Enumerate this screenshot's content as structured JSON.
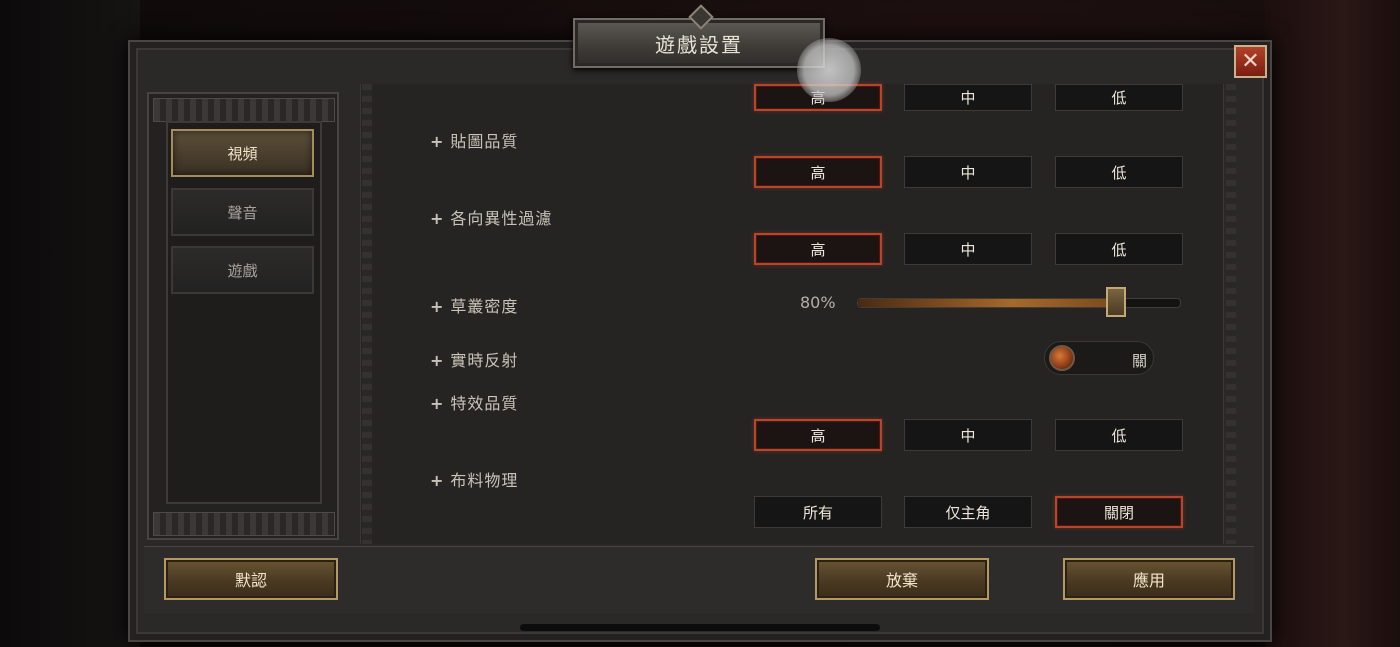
{
  "window": {
    "title": "遊戲設置",
    "close_symbol": "✕"
  },
  "sidebar": {
    "tabs": [
      {
        "label": "視頻",
        "active": true
      },
      {
        "label": "聲音",
        "active": false
      },
      {
        "label": "遊戲",
        "active": false
      }
    ]
  },
  "settings": {
    "top_partial": {
      "options": [
        "高",
        "中",
        "低"
      ],
      "selected": "高"
    },
    "texture_quality": {
      "label": "貼圖品質",
      "options": [
        "高",
        "中",
        "低"
      ],
      "selected": "高"
    },
    "anisotropic_filtering": {
      "label": "各向異性過濾",
      "options": [
        "高",
        "中",
        "低"
      ],
      "selected": "高"
    },
    "foliage_density": {
      "label": "草叢密度",
      "value_text": "80%",
      "value": 0.8
    },
    "realtime_reflection": {
      "label": "實時反射",
      "state_text": "關",
      "on": false
    },
    "effects_quality": {
      "label": "特效品質",
      "options": [
        "高",
        "中",
        "低"
      ],
      "selected": "高"
    },
    "cloth_physics": {
      "label": "布料物理",
      "options": [
        "所有",
        "仅主角",
        "關閉"
      ],
      "selected": "關閉"
    }
  },
  "footer": {
    "default_label": "默認",
    "discard_label": "放棄",
    "apply_label": "應用"
  },
  "colors": {
    "accent_selected": "#b8452b",
    "gold_border": "#b49a62",
    "close_red": "#b2412a"
  },
  "icons": {
    "plus": "+"
  }
}
